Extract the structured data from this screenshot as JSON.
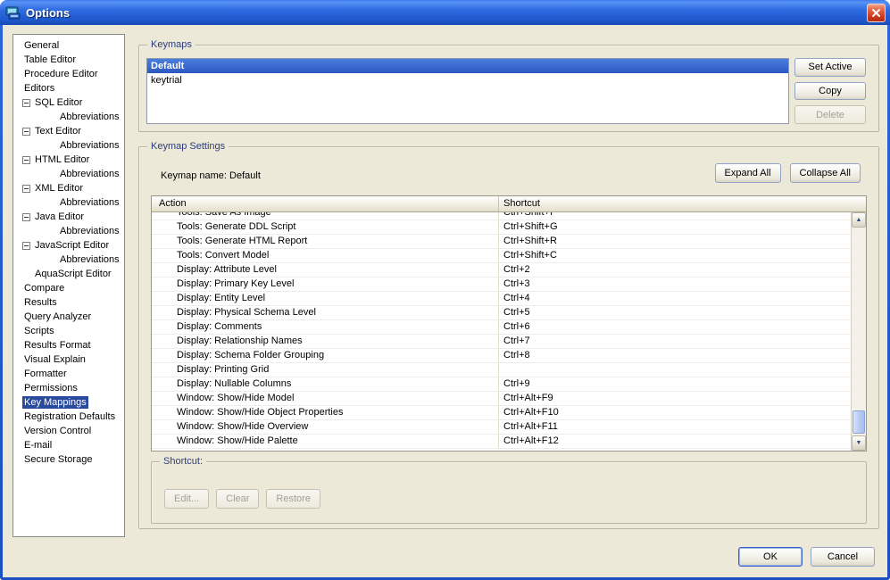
{
  "window": {
    "title": "Options"
  },
  "sidebar": {
    "items": [
      {
        "label": "General",
        "level": 0
      },
      {
        "label": "Table Editor",
        "level": 0
      },
      {
        "label": "Procedure Editor",
        "level": 0
      },
      {
        "label": "Editors",
        "level": 0
      },
      {
        "label": "SQL Editor",
        "level": 1,
        "expander": true
      },
      {
        "label": "Abbreviations",
        "level": 2
      },
      {
        "label": "Text Editor",
        "level": 1,
        "expander": true
      },
      {
        "label": "Abbreviations",
        "level": 2
      },
      {
        "label": "HTML Editor",
        "level": 1,
        "expander": true
      },
      {
        "label": "Abbreviations",
        "level": 2
      },
      {
        "label": "XML Editor",
        "level": 1,
        "expander": true
      },
      {
        "label": "Abbreviations",
        "level": 2
      },
      {
        "label": "Java Editor",
        "level": 1,
        "expander": true
      },
      {
        "label": "Abbreviations",
        "level": 2
      },
      {
        "label": "JavaScript Editor",
        "level": 1,
        "expander": true
      },
      {
        "label": "Abbreviations",
        "level": 2
      },
      {
        "label": "AquaScript Editor",
        "level": 1
      },
      {
        "label": "Compare",
        "level": 0
      },
      {
        "label": "Results",
        "level": 0
      },
      {
        "label": "Query Analyzer",
        "level": 0
      },
      {
        "label": "Scripts",
        "level": 0
      },
      {
        "label": "Results Format",
        "level": 0
      },
      {
        "label": "Visual Explain",
        "level": 0
      },
      {
        "label": "Formatter",
        "level": 0
      },
      {
        "label": "Permissions",
        "level": 0
      },
      {
        "label": "Key Mappings",
        "level": 0,
        "selected": true
      },
      {
        "label": "Registration Defaults",
        "level": 0
      },
      {
        "label": "Version Control",
        "level": 0
      },
      {
        "label": "E-mail",
        "level": 0
      },
      {
        "label": "Secure Storage",
        "level": 0
      }
    ]
  },
  "keymaps": {
    "group_title": "Keymaps",
    "items": [
      {
        "label": "Default",
        "selected": true
      },
      {
        "label": "keytrial",
        "selected": false
      }
    ],
    "buttons": {
      "set_active": "Set Active",
      "copy": "Copy",
      "delete": "Delete"
    }
  },
  "keymap_settings": {
    "group_title": "Keymap Settings",
    "keymap_name_label": "Keymap name: Default",
    "buttons": {
      "expand_all": "Expand All",
      "collapse_all": "Collapse All"
    },
    "table": {
      "columns": [
        "Action",
        "Shortcut"
      ],
      "rows": [
        {
          "action": "Tools: Save As Image",
          "shortcut": "Ctrl+Shift+I"
        },
        {
          "action": "Tools: Generate DDL Script",
          "shortcut": "Ctrl+Shift+G"
        },
        {
          "action": "Tools: Generate HTML Report",
          "shortcut": "Ctrl+Shift+R"
        },
        {
          "action": "Tools: Convert Model",
          "shortcut": "Ctrl+Shift+C"
        },
        {
          "action": "Display: Attribute Level",
          "shortcut": "Ctrl+2"
        },
        {
          "action": "Display: Primary Key Level",
          "shortcut": "Ctrl+3"
        },
        {
          "action": "Display: Entity Level",
          "shortcut": "Ctrl+4"
        },
        {
          "action": "Display: Physical Schema Level",
          "shortcut": "Ctrl+5"
        },
        {
          "action": "Display: Comments",
          "shortcut": "Ctrl+6"
        },
        {
          "action": "Display: Relationship Names",
          "shortcut": "Ctrl+7"
        },
        {
          "action": "Display: Schema Folder Grouping",
          "shortcut": "Ctrl+8"
        },
        {
          "action": "Display: Printing Grid",
          "shortcut": ""
        },
        {
          "action": "Display: Nullable Columns",
          "shortcut": "Ctrl+9"
        },
        {
          "action": "Window: Show/Hide Model",
          "shortcut": "Ctrl+Alt+F9"
        },
        {
          "action": "Window: Show/Hide Object Properties",
          "shortcut": "Ctrl+Alt+F10"
        },
        {
          "action": "Window: Show/Hide Overview",
          "shortcut": "Ctrl+Alt+F11"
        },
        {
          "action": "Window: Show/Hide Palette",
          "shortcut": "Ctrl+Alt+F12"
        }
      ]
    },
    "scrollbar": {
      "up_glyph": "▲",
      "down_glyph": "▼"
    },
    "shortcut_group": {
      "title": "Shortcut:",
      "buttons": {
        "edit": "Edit...",
        "clear": "Clear",
        "restore": "Restore"
      }
    }
  },
  "footer": {
    "ok": "OK",
    "cancel": "Cancel"
  }
}
